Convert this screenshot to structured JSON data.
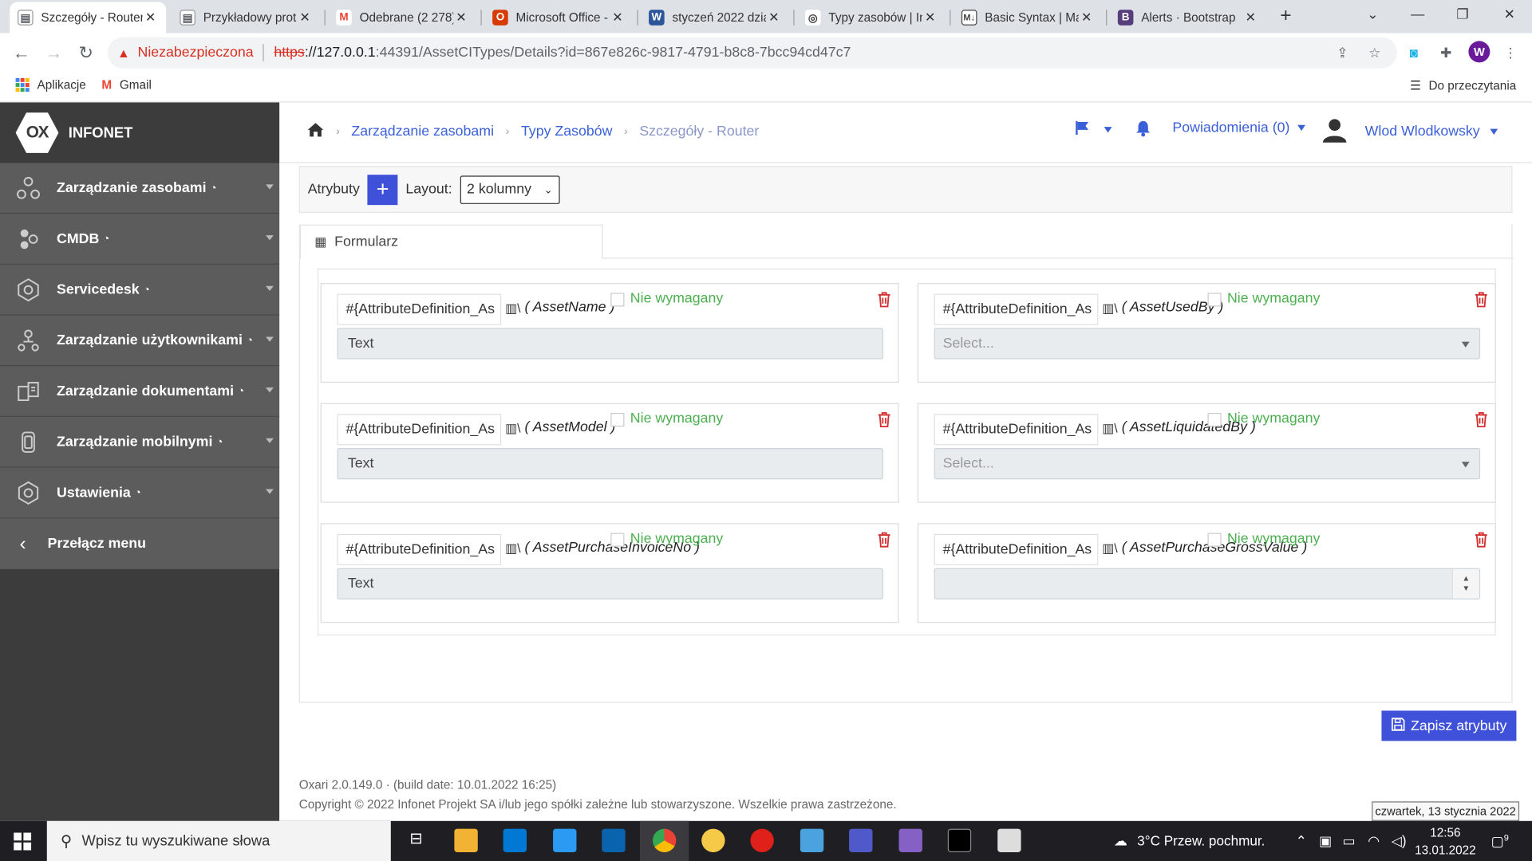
{
  "browser": {
    "tabs": [
      {
        "label": "Szczegóły - Router",
        "icon_color": "#5f6368",
        "icon_glyph": "▤"
      },
      {
        "label": "Przykładowy prot",
        "icon_color": "#5f6368",
        "icon_glyph": "▤"
      },
      {
        "label": "Odebrane (2 278)",
        "icon_color": "#ea4335",
        "icon_glyph": "M"
      },
      {
        "label": "Microsoft Office -",
        "icon_color": "#d83b01",
        "icon_glyph": "O"
      },
      {
        "label": "styczeń 2022 dzia",
        "icon_color": "#2b579a",
        "icon_glyph": "W"
      },
      {
        "label": "Typy zasobów | In",
        "icon_color": "#444",
        "icon_glyph": "◎"
      },
      {
        "label": "Basic Syntax | Ma",
        "icon_color": "#444",
        "icon_glyph": "M"
      },
      {
        "label": "Alerts · Bootstrap",
        "icon_color": "#563d7c",
        "icon_glyph": "B"
      }
    ],
    "address": {
      "warning": "Niezabezpieczona",
      "scheme": "https",
      "host": "://127.0.0.1",
      "rest": ":44391/AssetCITypes/Details?id=867e826c-9817-4791-b8c8-7bcc94cd47c7"
    },
    "profile_initial": "W",
    "bookmarks": {
      "apps": "Aplikacje",
      "gmail": "Gmail",
      "reading_list": "Do przeczytania"
    }
  },
  "sidebar": {
    "logo": "OX",
    "brand": "INFONET",
    "items": [
      {
        "label": "Zarządzanie zasobami",
        "icon": "assets-icon"
      },
      {
        "label": "CMDB",
        "icon": "cmdb-icon"
      },
      {
        "label": "Servicedesk",
        "icon": "servicedesk-icon"
      },
      {
        "label": "Zarządzanie użytkownikami",
        "icon": "users-icon"
      },
      {
        "label": "Zarządzanie dokumentami",
        "icon": "documents-icon"
      },
      {
        "label": "Zarządzanie mobilnymi",
        "icon": "mobile-icon"
      },
      {
        "label": "Ustawienia",
        "icon": "settings-icon"
      }
    ],
    "toggle": "Przełącz menu"
  },
  "header": {
    "breadcrumb": [
      "Zarządzanie zasobami",
      "Typy Zasobów",
      "Szczegóły - Router"
    ],
    "notifications": "Powiadomienia (0)",
    "user": "Wlod Wlodkowsky"
  },
  "toolbar": {
    "attributes_label": "Atrybuty",
    "add_label": "+",
    "layout_label": "Layout:",
    "layout_value": "2 kolumny"
  },
  "form": {
    "tab_label": "Formularz",
    "cards": [
      {
        "name_value": "#{AttributeDefinition_As",
        "attr": "( AssetName )",
        "required": "Nie wymagany",
        "value": "Text",
        "kind": "text"
      },
      {
        "name_value": "#{AttributeDefinition_As",
        "attr": "( AssetUsedBy )",
        "required": "Nie wymagany",
        "value": "Select...",
        "kind": "select"
      },
      {
        "name_value": "#{AttributeDefinition_As",
        "attr": "( AssetModel )",
        "required": "Nie wymagany",
        "value": "Text",
        "kind": "text"
      },
      {
        "name_value": "#{AttributeDefinition_As",
        "attr": "( AssetLiquidatedBy )",
        "required": "Nie wymagany",
        "value": "Select...",
        "kind": "select"
      },
      {
        "name_value": "#{AttributeDefinition_As",
        "attr": "( AssetPurchaseInvoiceNo )",
        "required": "Nie wymagany",
        "value": "Text",
        "kind": "text"
      },
      {
        "name_value": "#{AttributeDefinition_As",
        "attr": "( AssetPurchaseGrossValue )",
        "required": "Nie wymagany",
        "value": "",
        "kind": "number"
      }
    ],
    "save_label": "Zapisz atrybuty"
  },
  "footer": {
    "version": "Oxari 2.0.149.0 · (build date: 10.01.2022 16:25)",
    "copyright": "Copyright © 2022 Infonet Projekt SA i/lub jego spółki zależne lub stowarzyszone. Wszelkie prawa zastrzeżone."
  },
  "taskbar": {
    "search_placeholder": "Wpisz tu wyszukiwane słowa",
    "weather": "3°C  Przew. pochmur.",
    "time": "12:56",
    "date": "13.01.2022",
    "tooltip": "czwartek, 13 stycznia 2022",
    "notif_count": "9"
  },
  "colors": {
    "accent": "#3f51d9",
    "link": "#3a5fd8",
    "required": "#4caf50",
    "delete": "#d32f2f",
    "sidebar": "#3c3c3c"
  }
}
